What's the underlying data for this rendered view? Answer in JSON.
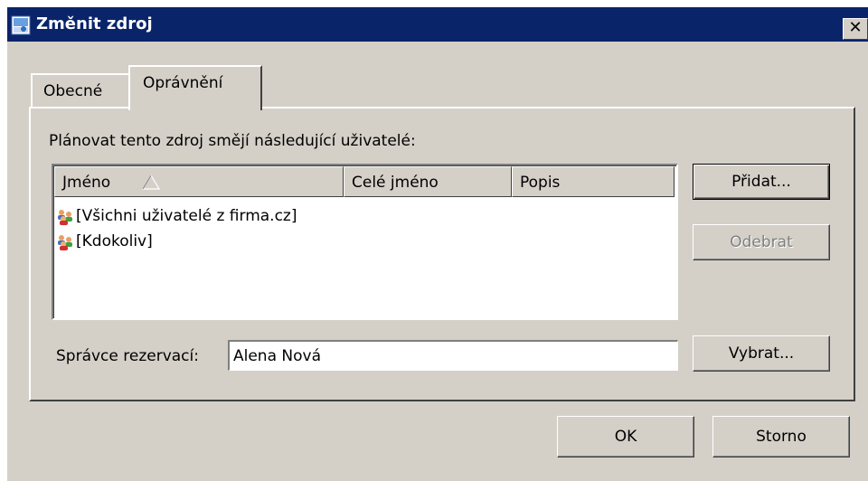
{
  "window": {
    "title": "Změnit zdroj",
    "close_label": "✕",
    "icon": "resource-icon"
  },
  "tabs": [
    {
      "label": "Obecné",
      "active": false
    },
    {
      "label": "Oprávnění",
      "active": true
    }
  ],
  "permissions": {
    "label": "Plánovat tento zdroj smějí následující uživatelé:",
    "columns": [
      "Jméno",
      "Celé jméno",
      "Popis"
    ],
    "sort_icon": "sort-ascending-icon",
    "rows": [
      {
        "name": "[Všichni uživatelé z firma.cz]",
        "full_name": "",
        "description": "",
        "icon": "users-group-icon"
      },
      {
        "name": "[Kdokoliv]",
        "full_name": "",
        "description": "",
        "icon": "users-group-icon"
      }
    ],
    "add_button": "Přidat...",
    "remove_button": "Odebrat"
  },
  "manager": {
    "label": "Správce rezervací:",
    "value": "Alena Nová",
    "select_button": "Vybrat..."
  },
  "footer": {
    "ok": "OK",
    "cancel": "Storno"
  },
  "colors": {
    "titlebar": "#0a246a",
    "face": "#d4d0c8"
  }
}
